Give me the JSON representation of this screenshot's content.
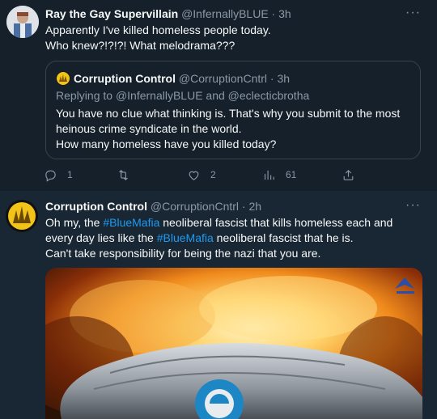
{
  "tweet1": {
    "display_name": "Ray the Gay Supervillain",
    "handle": "@InfernallyBLUE",
    "separator": "·",
    "time": "3h",
    "more": "···",
    "text_lines": [
      "Apparently I've killed homeless people today.",
      "Who knew?!?!?! What melodrama???"
    ],
    "quote": {
      "display_name": "Corruption Control",
      "handle": "@CorruptionCntrl",
      "separator": "·",
      "time": "3h",
      "replying_prefix": "Replying to",
      "replying_user1": "@InfernallyBLUE",
      "replying_and": "and",
      "replying_user2": "@eclecticbrotha",
      "text_lines": [
        "You have no clue what thinking is.  That's why you submit to the most",
        "heinous crime syndicate in the world.",
        "How many homeless have you killed today?"
      ]
    },
    "actions": {
      "reply_count": "1",
      "retweet_count": "",
      "like_count": "2",
      "views_count": "61"
    }
  },
  "tweet2": {
    "display_name": "Corruption Control",
    "handle": "@CorruptionCntrl",
    "separator": "·",
    "time": "2h",
    "more": "···",
    "line1_a": "Oh my, the ",
    "line1_tag": "#BlueMafia",
    "line1_b": " neoliberal fascist that kills homeless each and",
    "line2_a": "every day lies like the ",
    "line2_tag": "#BlueMafia",
    "line2_b": " neoliberal fascist that he is.",
    "line3": "Can't take responsibility for being the nazi that you are."
  },
  "colors": {
    "background": "#15202b",
    "text": "#f7f9f9",
    "secondary": "#8b98a5",
    "link": "#1d9bf0",
    "border": "#38444d"
  },
  "icons": {
    "more": "ellipsis-icon",
    "reply": "reply-icon",
    "retweet": "retweet-icon",
    "like": "heart-icon",
    "views": "views-icon",
    "share": "share-icon"
  }
}
